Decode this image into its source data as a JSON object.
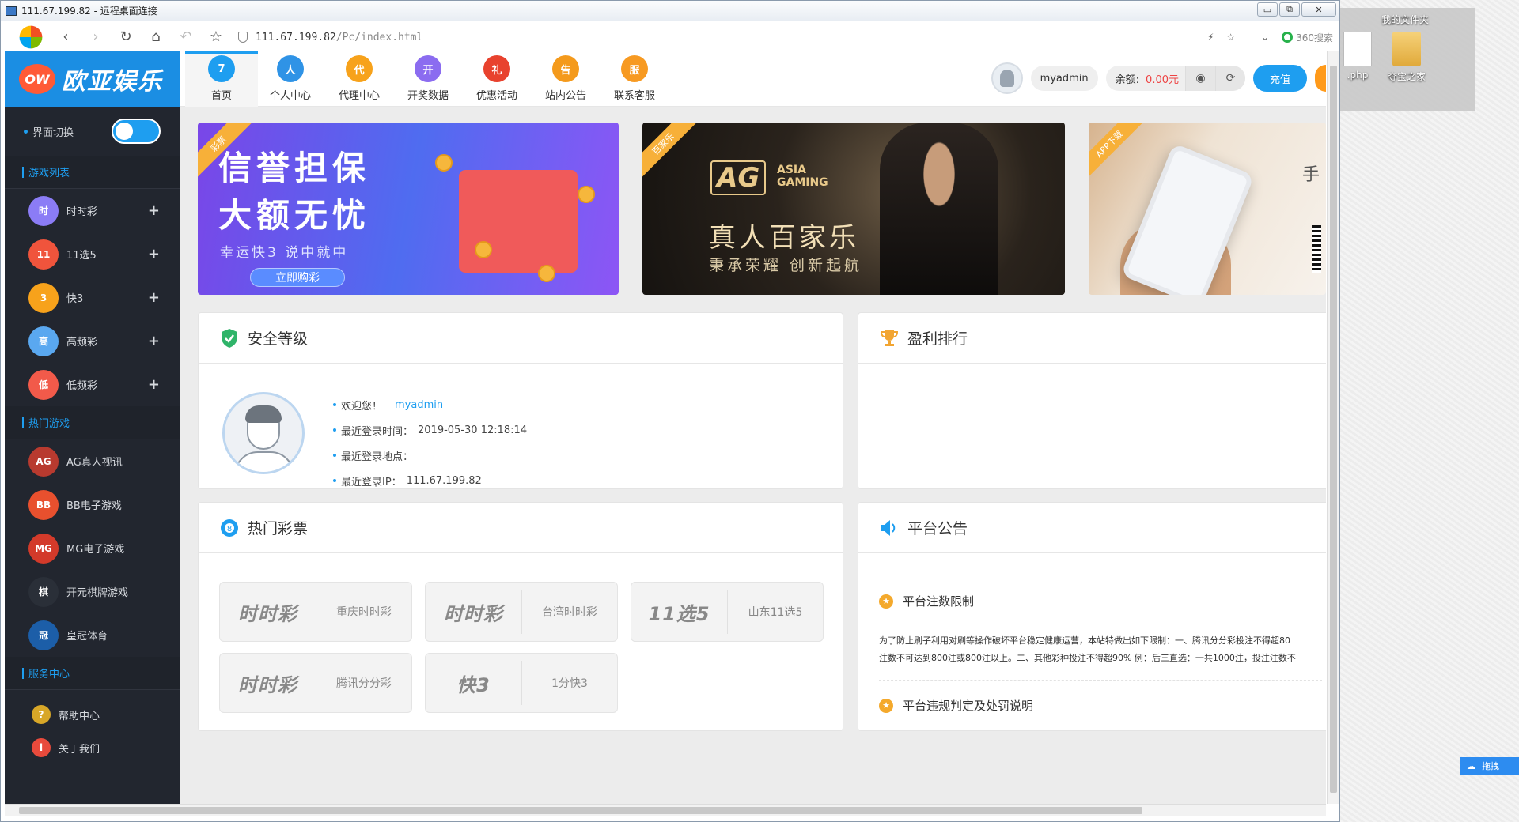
{
  "rdp": {
    "title": "111.67.199.82 - 远程桌面连接",
    "buttons": {
      "minimize": "▭",
      "restore": "⧉",
      "close": "✕"
    }
  },
  "browser": {
    "url_host": "111.67.199.82",
    "url_path": "/Pc/index.html",
    "search_engine": "360搜索"
  },
  "desktop": {
    "top_label": "我的文件夹",
    "icons": [
      {
        "label": ".php",
        "icon": "document-icon"
      },
      {
        "label": "夺宝之家",
        "icon": "folder-icon"
      }
    ],
    "baidu_button": "拖拽"
  },
  "sidebar": {
    "logo_badge": "OW",
    "logo_text": "欧亚娱乐",
    "switch_label": "界面切换",
    "switch_on": true,
    "sections": {
      "games": "游戏列表",
      "hot": "热门游戏",
      "service": "服务中心"
    },
    "games": [
      {
        "label": "时时彩",
        "icon_text": "时",
        "color": "#8b7cf6"
      },
      {
        "label": "11选5",
        "icon_text": "11",
        "color": "#f0543c"
      },
      {
        "label": "快3",
        "icon_text": "3",
        "color": "#f7a21b"
      },
      {
        "label": "高频彩",
        "icon_text": "高",
        "color": "#5aa8f0"
      },
      {
        "label": "低频彩",
        "icon_text": "低",
        "color": "#f25a4a"
      }
    ],
    "hot_games": [
      {
        "label": "AG真人视讯",
        "icon_text": "AG",
        "color": "#b83a2f"
      },
      {
        "label": "BB电子游戏",
        "icon_text": "BB",
        "color": "#e8502e"
      },
      {
        "label": "MG电子游戏",
        "icon_text": "MG",
        "color": "#d33a2a"
      },
      {
        "label": "开元棋牌游戏",
        "icon_text": "棋",
        "color": "#2a2f38"
      },
      {
        "label": "皇冠体育",
        "icon_text": "冠",
        "color": "#1c5ea8"
      }
    ],
    "services": [
      {
        "label": "帮助中心",
        "icon_text": "?",
        "color": "#d8a728"
      },
      {
        "label": "关于我们",
        "icon_text": "i",
        "color": "#e84a3c"
      }
    ]
  },
  "topnav": {
    "tabs": [
      {
        "label": "首页",
        "icon_text": "7",
        "color": "#1e9ef0",
        "active": true
      },
      {
        "label": "个人中心",
        "icon_text": "人",
        "color": "#2f93e6"
      },
      {
        "label": "代理中心",
        "icon_text": "代",
        "color": "#f7a21b"
      },
      {
        "label": "开奖数据",
        "icon_text": "开",
        "color": "#8b6cf0"
      },
      {
        "label": "优惠活动",
        "icon_text": "礼",
        "color": "#e8422e"
      },
      {
        "label": "站内公告",
        "icon_text": "告",
        "color": "#f49a1c"
      },
      {
        "label": "联系客服",
        "icon_text": "服",
        "color": "#f79a22"
      }
    ],
    "username": "myadmin",
    "balance_label": "余额:",
    "balance_value": "0.00元",
    "recharge_label": "充值"
  },
  "banners": [
    {
      "ribbon": "彩票",
      "line1": "信誉担保",
      "line2": "大额无忧",
      "sub": "幸运快3   说中就中",
      "cta": "立即购彩"
    },
    {
      "ribbon": "百家乐",
      "brand": "AG",
      "brand_sub1": "ASIA",
      "brand_sub2": "GAMING",
      "line1": "真人百家乐",
      "line2": "秉承荣耀 创新起航"
    },
    {
      "ribbon": "APP下载",
      "side_text": "手"
    }
  ],
  "security": {
    "title": "安全等级",
    "welcome_label": "欢迎您！",
    "welcome_user": "myadmin",
    "last_login_time_label": "最近登录时间：",
    "last_login_time": "2019-05-30 12:18:14",
    "last_login_place_label": "最近登录地点：",
    "last_login_place": "",
    "last_login_ip_label": "最近登录IP：",
    "last_login_ip": "111.67.199.82"
  },
  "ranking": {
    "title": "盈利排行"
  },
  "hot_lottery": {
    "title": "热门彩票",
    "items": [
      {
        "logo": "时时彩",
        "name": "重庆时时彩"
      },
      {
        "logo": "时时彩",
        "name": "台湾时时彩"
      },
      {
        "logo": "11选5",
        "name": "山东11选5"
      },
      {
        "logo": "时时彩",
        "name": "腾讯分分彩"
      },
      {
        "logo": "快3",
        "name": "1分快3"
      }
    ]
  },
  "notice": {
    "title": "平台公告",
    "item1": "平台注数限制",
    "text_line1": "为了防止刷子利用对刷等操作破坏平台稳定健康运营，本站特做出如下限制：一、腾讯分分彩投注不得超80",
    "text_line2": "注数不可达到800注或800注以上。二、其他彩种投注不得超90% 例：后三直选：一共1000注，投注注数不",
    "item2": "平台违规判定及处罚说明"
  }
}
